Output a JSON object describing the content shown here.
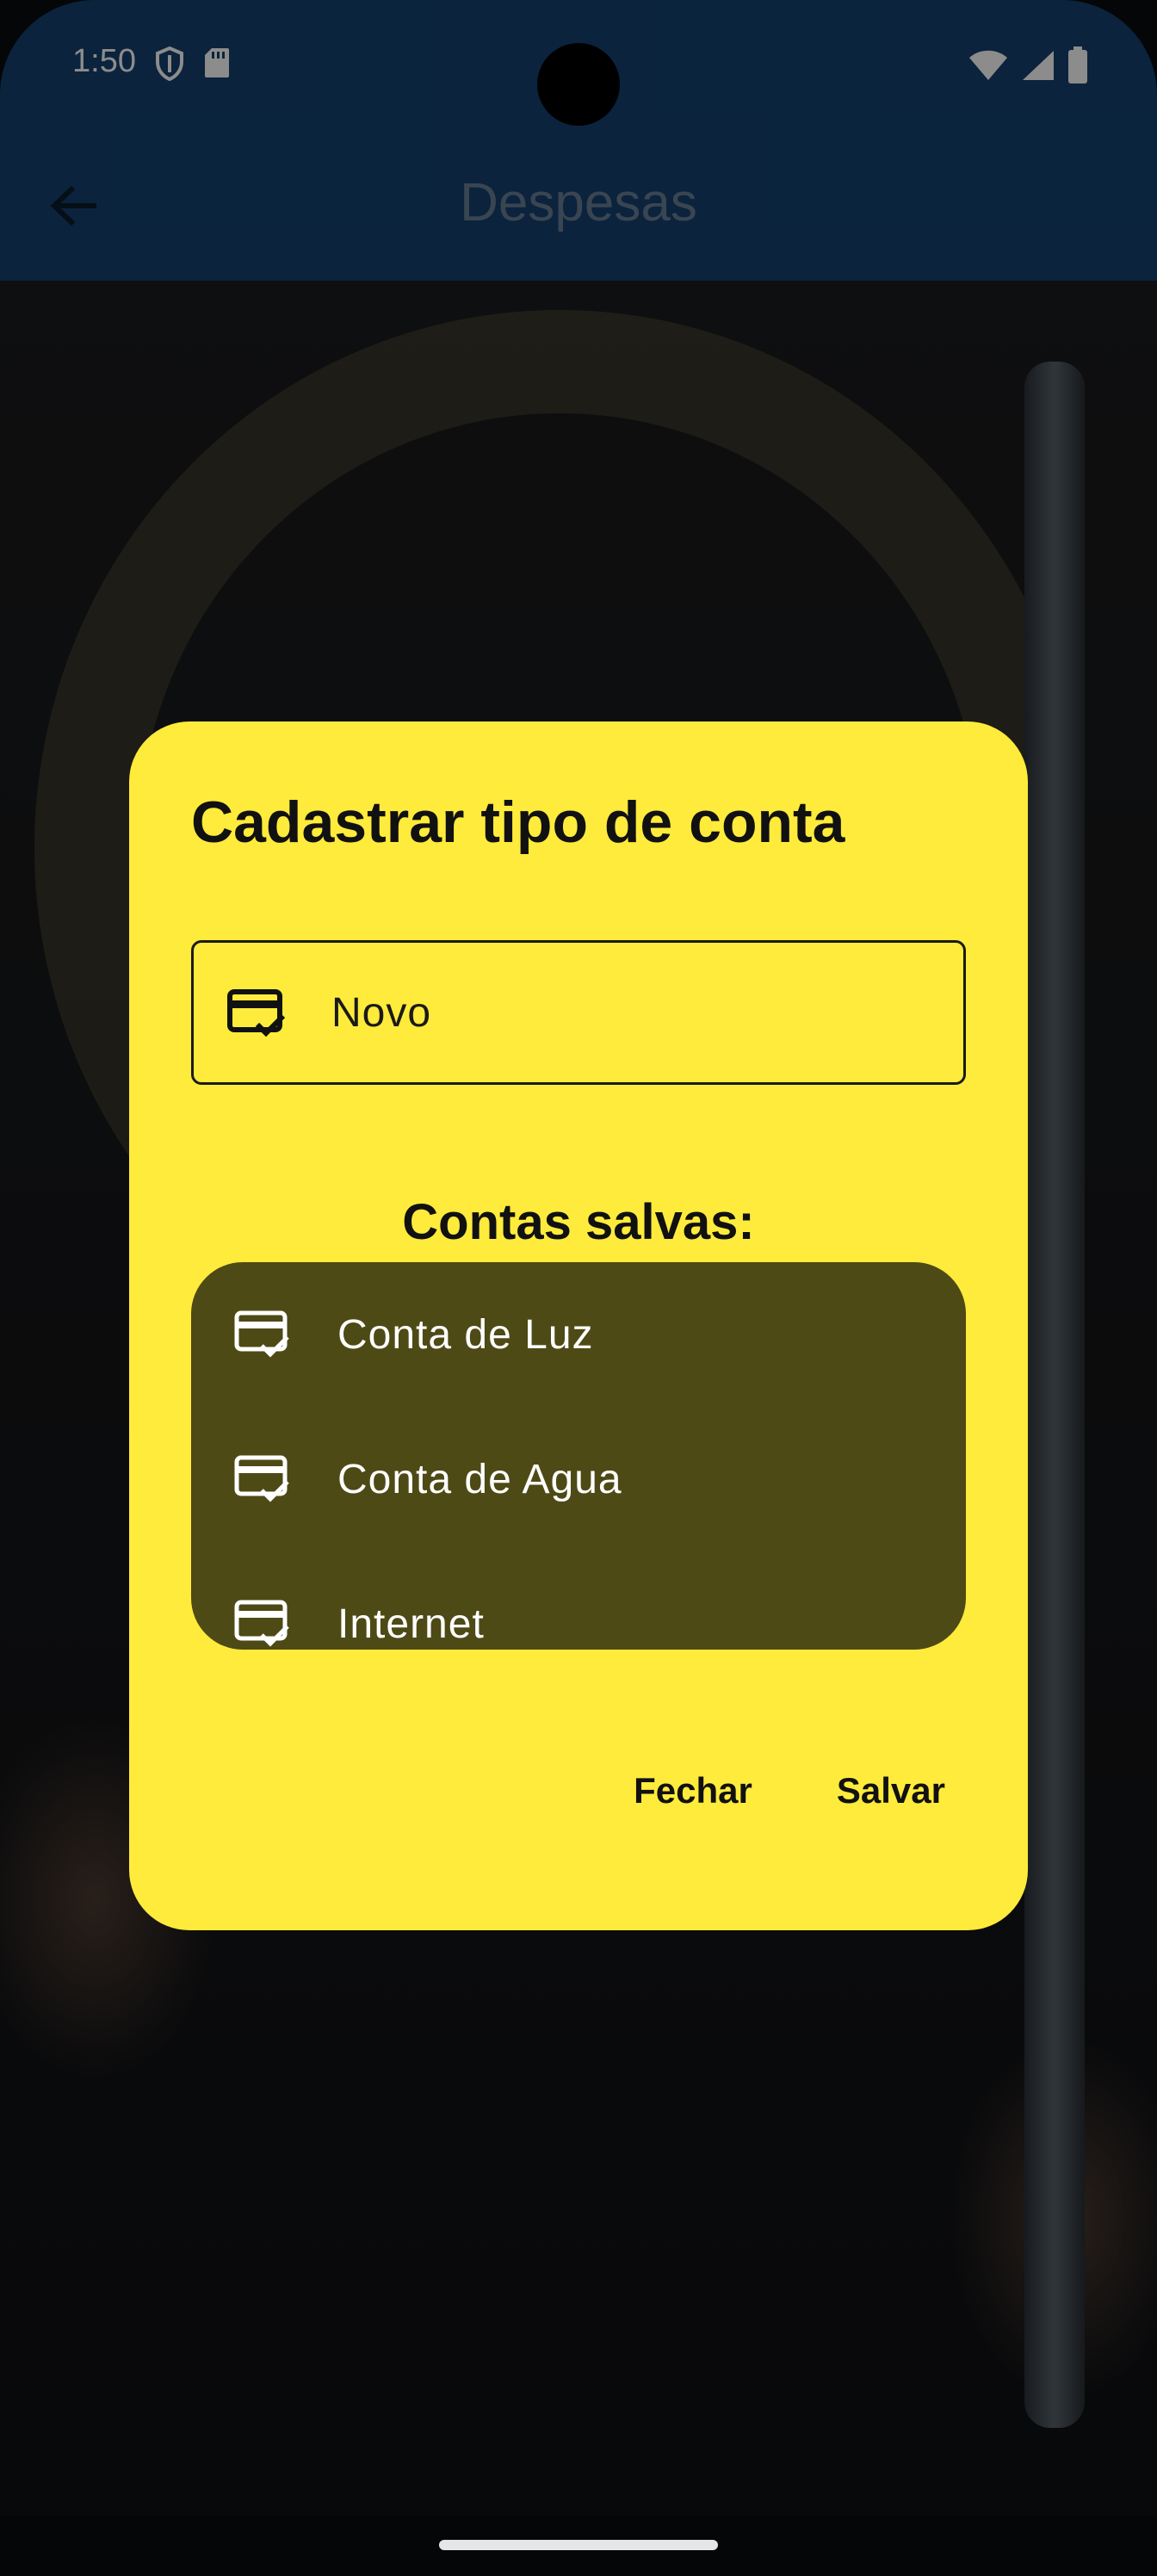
{
  "status_bar": {
    "time": "1:50",
    "left_icons": [
      "shield-icon",
      "sd-card-icon"
    ],
    "right_icons": [
      "wifi-icon",
      "signal-icon",
      "battery-icon"
    ]
  },
  "app_bar": {
    "title": "Despesas",
    "back_icon": "arrow-back-icon",
    "background_color": "#144170"
  },
  "dialog": {
    "title": "Cadastrar tipo de conta",
    "background_color": "#ffeb3b",
    "input": {
      "icon": "card-check-icon",
      "value": "Novo"
    },
    "saved_heading": "Contas salvas:",
    "saved_items": [
      {
        "label": "Conta de Luz",
        "icon": "card-check-icon"
      },
      {
        "label": "Conta de Agua",
        "icon": "card-check-icon"
      },
      {
        "label": "Internet",
        "icon": "card-check-icon"
      }
    ],
    "actions": {
      "close_label": "Fechar",
      "save_label": "Salvar"
    }
  }
}
